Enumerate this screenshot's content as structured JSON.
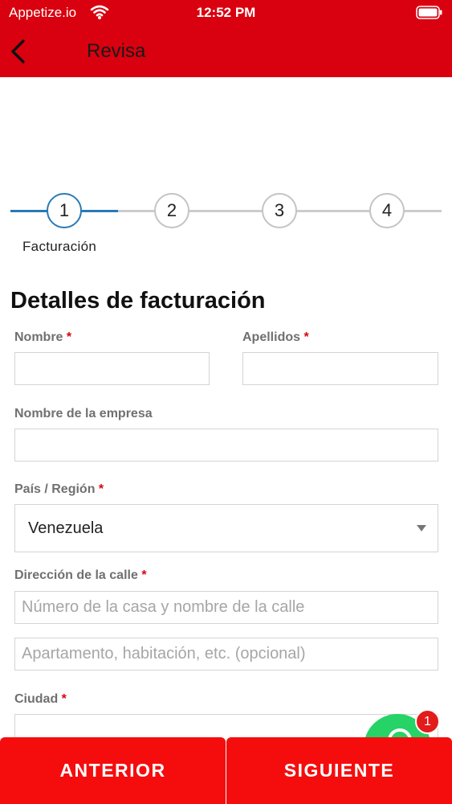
{
  "status_bar": {
    "carrier": "Appetize.io",
    "time": "12:52 PM"
  },
  "nav": {
    "title": "Revisa"
  },
  "stepper": {
    "steps": [
      "1",
      "2",
      "3",
      "4"
    ],
    "active_label": "Facturación"
  },
  "form": {
    "title": "Detalles de facturación",
    "required_mark": "*",
    "nombre": {
      "label": "Nombre",
      "value": ""
    },
    "apellidos": {
      "label": "Apellidos",
      "value": ""
    },
    "empresa": {
      "label": "Nombre de la empresa",
      "value": ""
    },
    "pais": {
      "label": "País / Región",
      "value": "Venezuela"
    },
    "direccion": {
      "label": "Dirección de la calle",
      "placeholder1": "Número de la casa y nombre de la calle",
      "placeholder2": "Apartamento, habitación, etc. (opcional)"
    },
    "ciudad": {
      "label": "Ciudad",
      "value": ""
    }
  },
  "chat": {
    "badge_count": "1"
  },
  "buttons": {
    "prev": "ANTERIOR",
    "next": "SIGUIENTE"
  },
  "colors": {
    "brand_red": "#d9000f",
    "button_red": "#f50d0d",
    "step_blue": "#2a7ab5",
    "whatsapp_green": "#25d366"
  }
}
